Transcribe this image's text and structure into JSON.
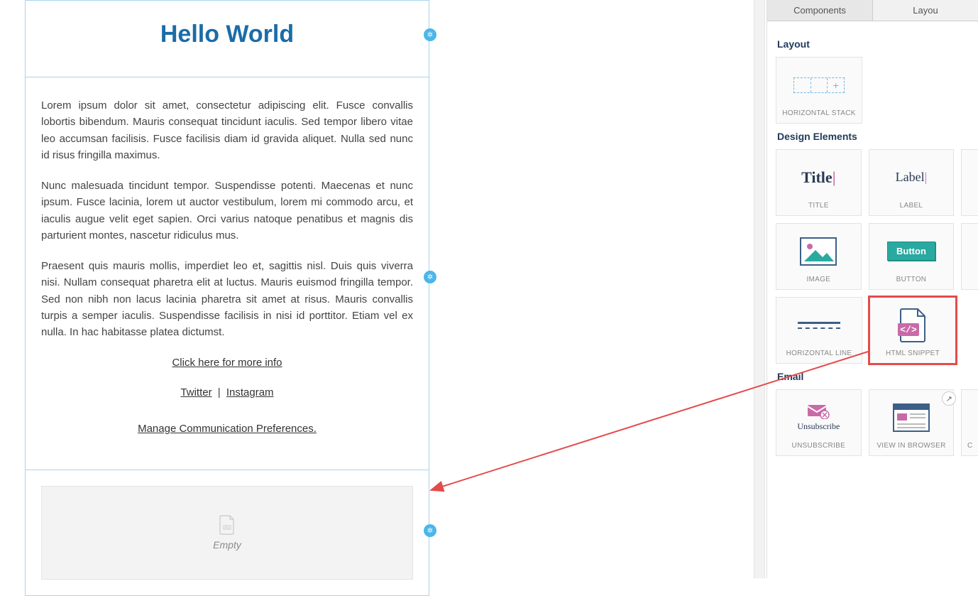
{
  "canvas": {
    "title": "Hello World",
    "para1": "Lorem ipsum dolor sit amet, consectetur adipiscing elit. Fusce convallis lobortis bibendum. Mauris consequat tincidunt iaculis. Sed tempor libero vitae leo accumsan facilisis. Fusce facilisis diam id gravida aliquet. Nulla sed nunc id risus fringilla maximus.",
    "para2": "Nunc malesuada tincidunt tempor. Suspendisse potenti. Maecenas et nunc ipsum. Fusce lacinia, lorem ut auctor vestibulum, lorem mi commodo arcu, et iaculis augue velit eget sapien. Orci varius natoque penatibus et magnis dis parturient montes, nascetur ridiculus mus.",
    "para3": "Praesent quis mauris mollis, imperdiet leo et, sagittis nisl. Duis quis viverra nisi. Nullam consequat pharetra elit at luctus. Mauris euismod fringilla tempor. Sed non nibh non lacus lacinia pharetra sit amet at risus. Mauris convallis turpis a semper iaculis. Suspendisse facilisis in nisi id porttitor. Etiam vel ex nulla. In hac habitasse platea dictumst.",
    "more_link": "Click here for more info",
    "twitter": "Twitter",
    "sep": "|",
    "instagram": "Instagram",
    "manage": "Manage Communication Preferences.",
    "empty_label": "Empty"
  },
  "panel": {
    "tab_components": "Components",
    "tab_layout": "Layou",
    "section_layout": "Layout",
    "section_design": "Design Elements",
    "section_email": "Email",
    "cards": {
      "hstack": "HORIZONTAL STACK",
      "title": "TITLE",
      "title_thumb": "Title",
      "label": "LABEL",
      "label_thumb": "Label",
      "image": "IMAGE",
      "button": "BUTTON",
      "button_thumb": "Button",
      "hline": "HORIZONTAL LINE",
      "htmlsnip": "HTML SNIPPET",
      "unsub": "UNSUBSCRIBE",
      "unsub_thumb": "Unsubscribe",
      "vib": "VIEW IN BROWSER",
      "partial": "C"
    }
  }
}
